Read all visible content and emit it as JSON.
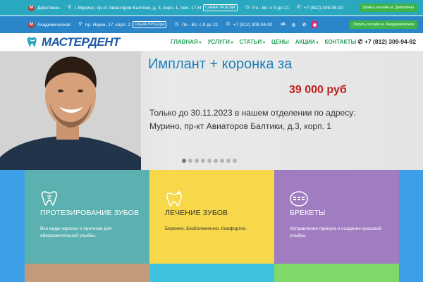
{
  "top_bar_1": {
    "metro_icon": "metro-icon",
    "metro_letter": "М",
    "station": "Девяткино",
    "address": "г. Мурино, пр-кт Авиаторов Балтики, д. 3, корп. 1, пом. 17-Н",
    "scheme": "СХЕМА ПРОЕЗДА",
    "hours": "Пн - Вс: с 9 до 21",
    "phone": "+7 (812) 309-35-92",
    "book": "Запись онлайн м. Девяткино"
  },
  "top_bar_2": {
    "metro_letter": "М",
    "station": "Академическая",
    "address": "пр. Науки, 17, корп. 2",
    "scheme": "СХЕМА ПРОЕЗДА",
    "hours": "Пн - Вс: с 9 до 21",
    "phone": "+7 (812) 309-94-92",
    "social": [
      "vk-icon",
      "whatsapp-icon",
      "viber-icon",
      "instagram-icon"
    ],
    "book": "Запись онлайн м. Академическая"
  },
  "nav": {
    "logo_text": "МАСТЕРДЕНТ",
    "menu": [
      "ГЛАВНАЯ",
      "УСЛУГИ",
      "СТАТЬИ",
      "ЦЕНЫ",
      "АКЦИИ",
      "КОНТАКТЫ"
    ],
    "phone": "+7 (812) 309-94-92"
  },
  "hero": {
    "title": "Имплант + коронка за",
    "price": "39 000 руб",
    "line1": "Только до 30.11.2023 в нашем отделении по адресу:",
    "line2": "Мурино, пр-кт Авиаторов Балтики, д.3, корп. 1",
    "slides": 9,
    "active_slide": 1
  },
  "services": [
    {
      "title": "ПРОТЕЗИРОВАНИЕ ЗУБОВ",
      "text": "Все виды коронок и протезов для обворожительной улыбки.",
      "icon": "tooth-implant-icon"
    },
    {
      "title": "ЛЕЧЕНИЕ ЗУБОВ",
      "text": "Бережно. Безболезненно. Комфортно.",
      "icon": "tooth-sparkle-icon"
    },
    {
      "title": "БРЕКЕТЫ",
      "text": "Исправление прикуса и создание красивой улыбки.",
      "icon": "braces-icon"
    }
  ],
  "colors": {
    "bar1": "#2aa8c0",
    "bar2": "#2a86c8",
    "menu": "#2aa05a",
    "title": "#1d7fb8",
    "price": "#c02020"
  }
}
